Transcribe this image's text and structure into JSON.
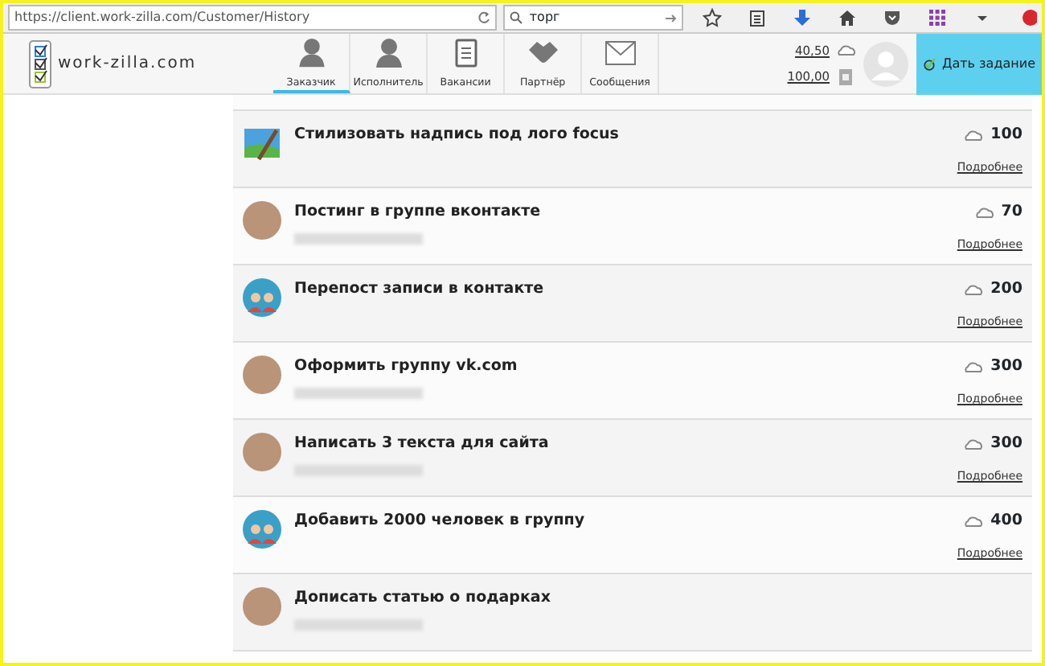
{
  "browser": {
    "url": "https://client.work-zilla.com/Customer/History",
    "search": "торг"
  },
  "header": {
    "logo": "work-zilla.com",
    "tabs": [
      {
        "label": "Заказчик",
        "selected": true
      },
      {
        "label": "Исполнитель",
        "selected": false
      },
      {
        "label": "Вакансии",
        "selected": false
      },
      {
        "label": "Партнёр",
        "selected": false
      },
      {
        "label": "Сообщения",
        "selected": false
      }
    ],
    "balance": [
      "40,50",
      "100,00"
    ],
    "button": "Дать задание"
  },
  "tasks": [
    {
      "title": "Стилизовать надпись под лого focus",
      "kind": "picture",
      "blurred_subtitle": false,
      "price": "100",
      "link": "Подробнее"
    },
    {
      "title": "Постинг в группе вконтакте",
      "kind": "photo",
      "blurred_subtitle": true,
      "price": "70",
      "link": "Подробнее"
    },
    {
      "title": "Перепост записи в контакте",
      "kind": "people",
      "blurred_subtitle": false,
      "price": "200",
      "link": "Подробнее"
    },
    {
      "title": "Оформить группу vk.com",
      "kind": "photo",
      "blurred_subtitle": true,
      "price": "300",
      "link": "Подробнее"
    },
    {
      "title": "Написать 3 текста для сайта",
      "kind": "photo",
      "blurred_subtitle": true,
      "price": "300",
      "link": "Подробнее"
    },
    {
      "title": "Добавить 2000 человек в группу",
      "kind": "people",
      "blurred_subtitle": false,
      "price": "400",
      "link": "Подробнее"
    },
    {
      "title": "Дописать статью о подарках",
      "kind": "photo",
      "blurred_subtitle": true
    }
  ]
}
